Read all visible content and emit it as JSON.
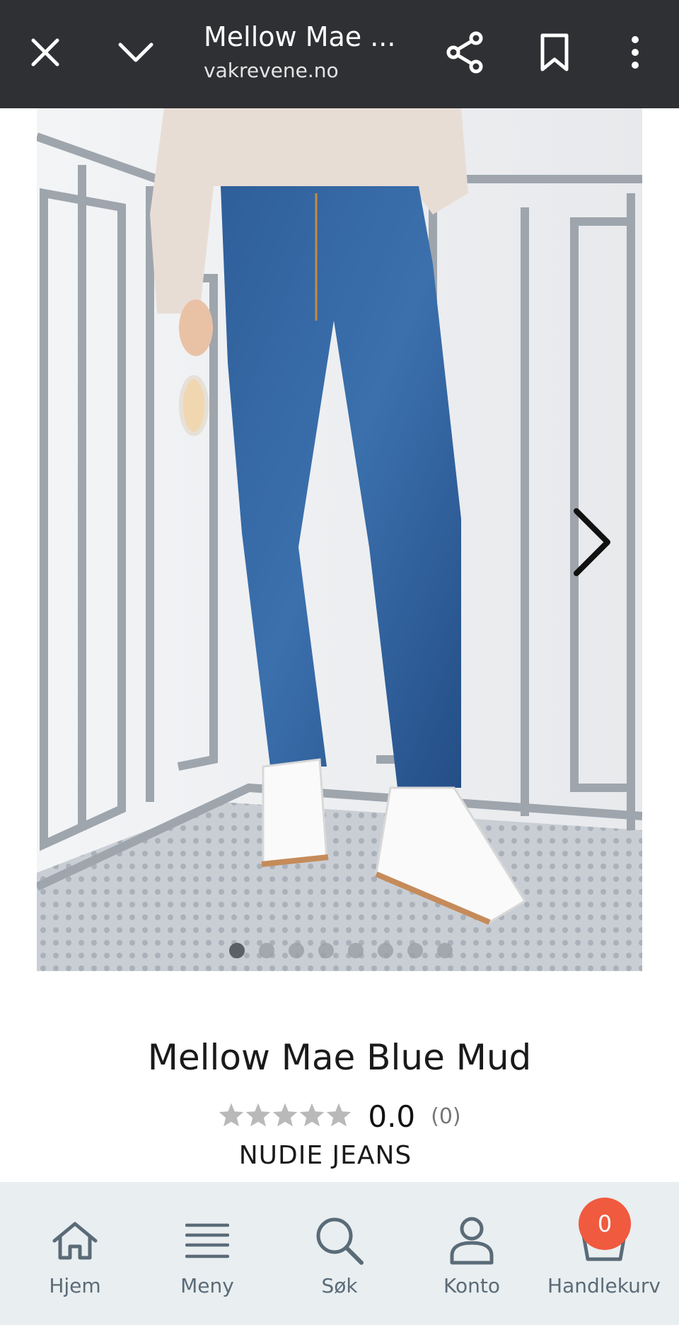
{
  "browser": {
    "title": "Mellow Mae ...",
    "url": "vakrevene.no",
    "icons": {
      "close": "close-icon",
      "minimize": "chevron-down-icon",
      "share": "share-icon",
      "bookmark": "bookmark-icon",
      "menu": "more-vert-icon"
    }
  },
  "gallery": {
    "image_count": 8,
    "active_index": 0,
    "next_icon": "chevron-right-icon"
  },
  "product": {
    "name": "Mellow Mae Blue Mud",
    "rating": {
      "stars_filled": 0,
      "stars_total": 5,
      "value": "0.0",
      "count": "(0)"
    },
    "brand": "NUDIE JEANS"
  },
  "bottom_nav": {
    "items": [
      {
        "label": "Hjem",
        "icon": "home-icon"
      },
      {
        "label": "Meny",
        "icon": "menu-icon"
      },
      {
        "label": "Søk",
        "icon": "search-icon"
      },
      {
        "label": "Konto",
        "icon": "user-icon"
      },
      {
        "label": "Handlekurv",
        "icon": "cart-icon"
      }
    ],
    "cart_badge": "0"
  },
  "colors": {
    "topbar": "#2f3033",
    "nav_background": "#e9eef0",
    "nav_text": "#5a6b78",
    "badge": "#f05a3f",
    "star_empty": "#b9b9b9"
  }
}
